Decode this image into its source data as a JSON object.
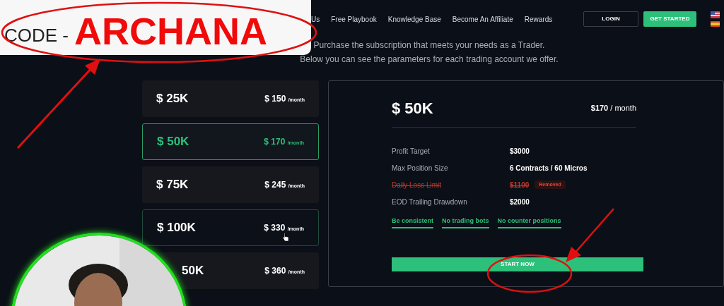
{
  "promo": {
    "label": "CODE -",
    "code": "ARCHANA"
  },
  "nav": {
    "items": [
      "Us",
      "Free Playbook",
      "Knowledge Base",
      "Become An Affiliate",
      "Rewards"
    ],
    "login": "LOGIN",
    "get_started": "GET STARTED"
  },
  "intro": [
    "Purchase the subscription that meets your needs as a Trader.",
    "Below you can see the parameters for each trading account we offer."
  ],
  "plans": [
    {
      "amount": "$ 25K",
      "price": "$ 150",
      "period": "/month",
      "selected": false,
      "hovered": false
    },
    {
      "amount": "$ 50K",
      "price": "$ 170",
      "period": "/month",
      "selected": true,
      "hovered": false
    },
    {
      "amount": "$ 75K",
      "price": "$ 245",
      "period": "/month",
      "selected": false,
      "hovered": false
    },
    {
      "amount": "$ 100K",
      "price": "$ 330",
      "period": "/month",
      "selected": false,
      "hovered": true
    },
    {
      "amount": "50K",
      "price": "$ 360",
      "period": "/month",
      "selected": false,
      "hovered": false
    }
  ],
  "detail": {
    "title": "$ 50K",
    "price": "$170",
    "period": "/ month",
    "params": [
      {
        "label": "Profit Target",
        "value": "$3000",
        "removed": false
      },
      {
        "label": "Max Position Size",
        "value": "6 Contracts / 60 Micros",
        "removed": false
      },
      {
        "label": "Daily Loss Limit",
        "value": "$1100",
        "removed": true,
        "badge": "Removed"
      },
      {
        "label": "EOD Trailing Drawdown",
        "value": "$2000",
        "removed": false
      }
    ],
    "rules": [
      "Be consistent",
      "No trading bots",
      "No counter positions"
    ],
    "button": "START NOW"
  }
}
